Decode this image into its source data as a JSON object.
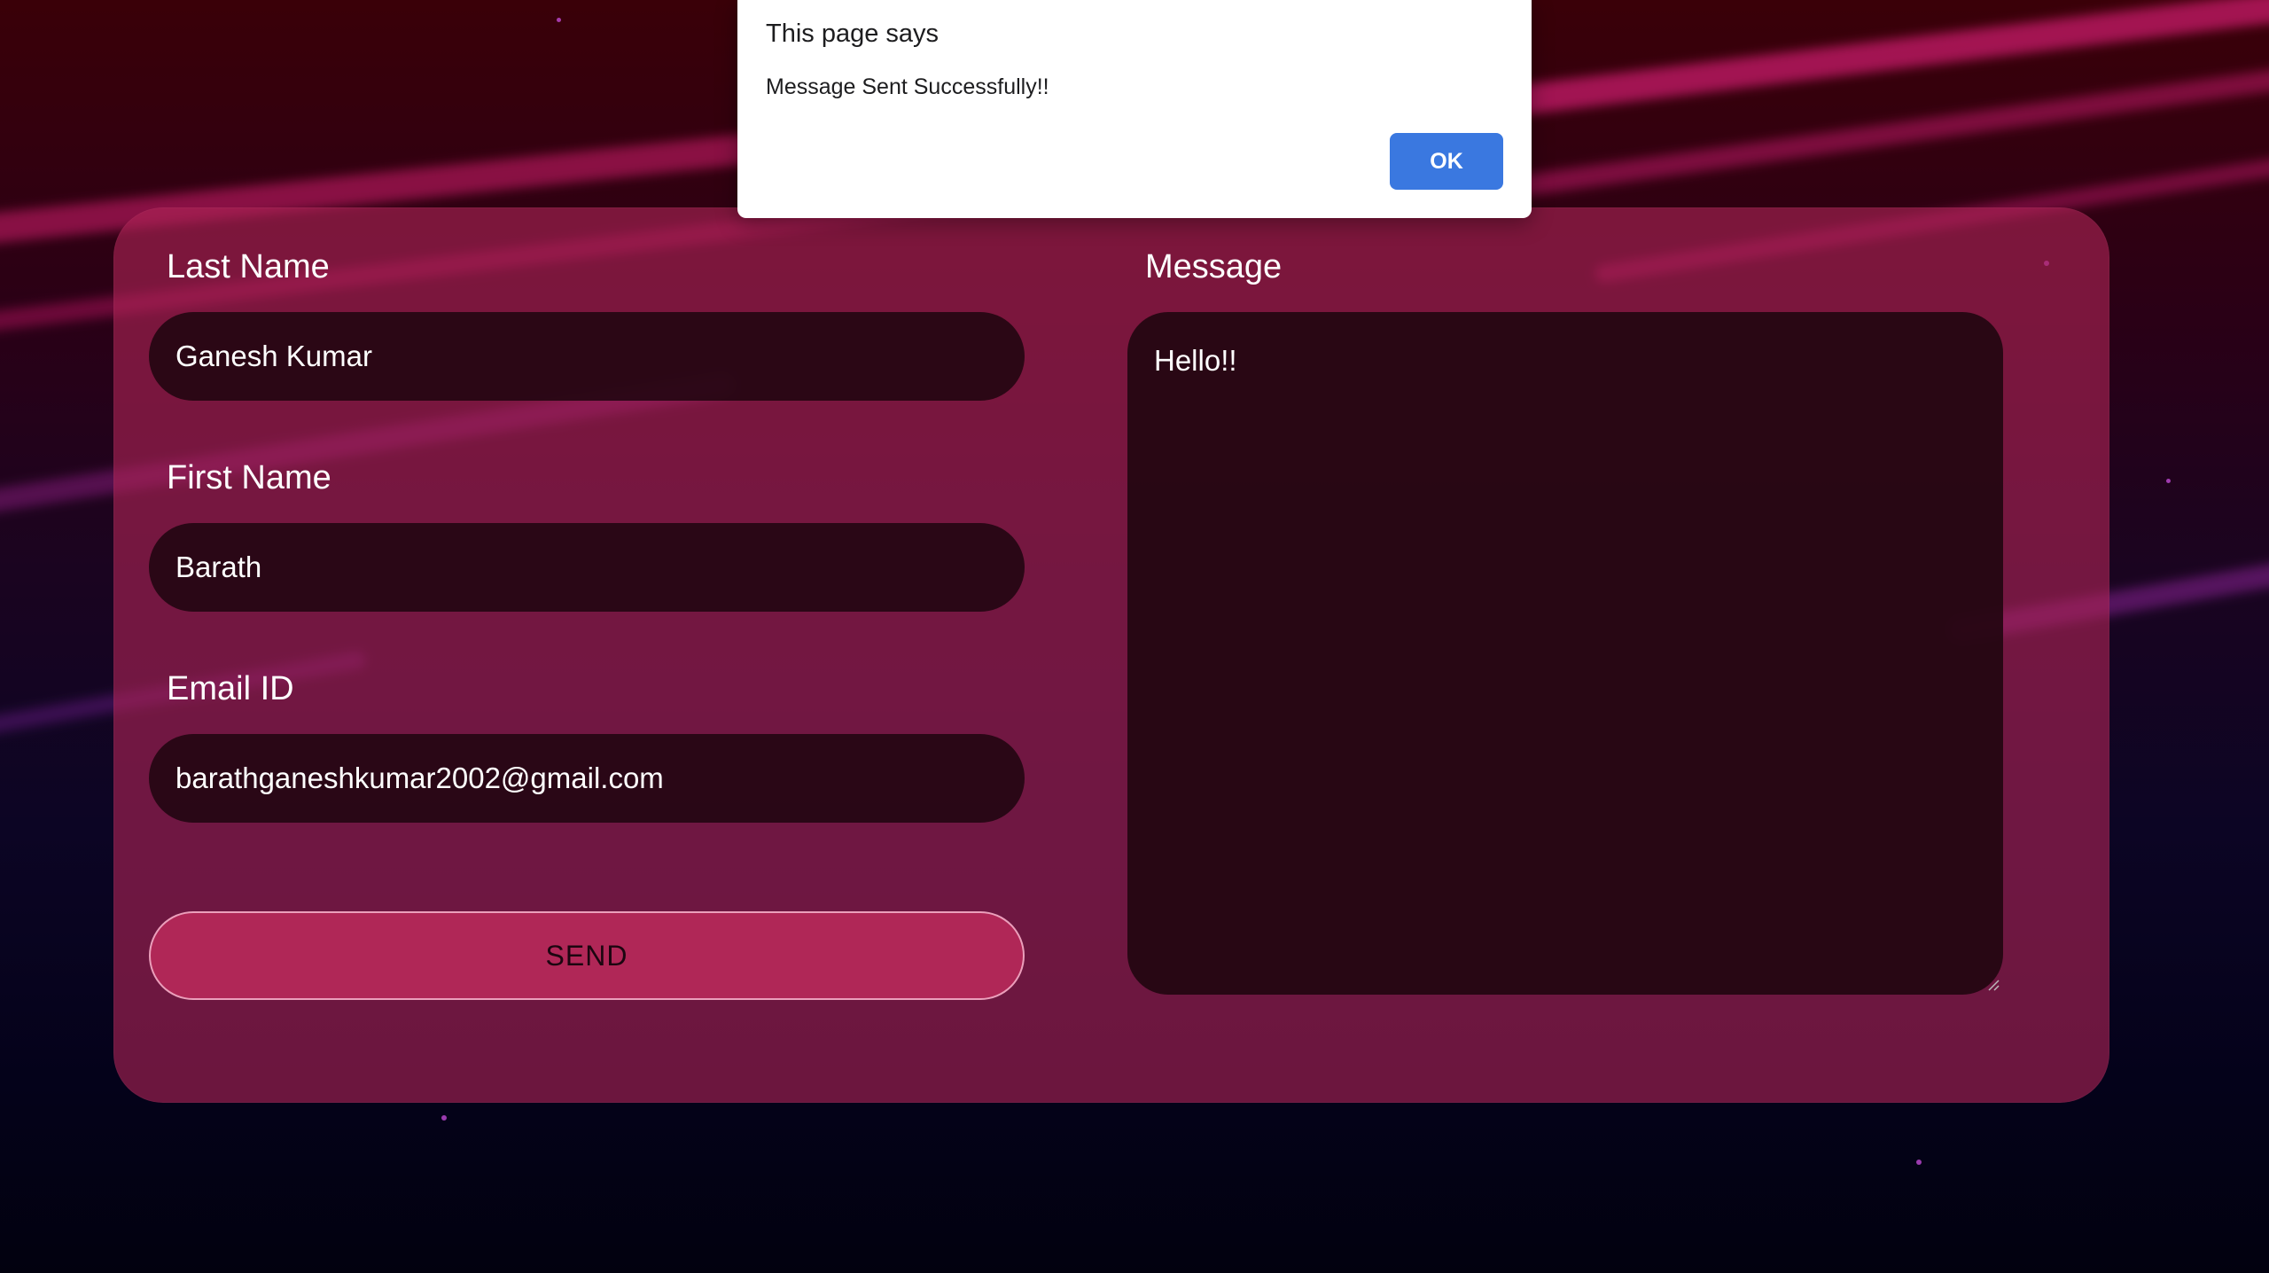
{
  "dialog": {
    "title": "This page says",
    "message": "Message Sent Successfully!!",
    "ok_label": "OK"
  },
  "form": {
    "last_name": {
      "label": "Last Name",
      "value": "Ganesh Kumar"
    },
    "first_name": {
      "label": "First Name",
      "value": "Barath"
    },
    "email": {
      "label": "Email ID",
      "value": "barathganeshkumar2002@gmail.com"
    },
    "message": {
      "label": "Message",
      "value": "Hello!!"
    },
    "send_label": "SEND"
  },
  "colors": {
    "card": "#ac2456",
    "input_bg": "#200610",
    "send_button": "#b02757",
    "dialog_ok": "#3a78e0"
  }
}
